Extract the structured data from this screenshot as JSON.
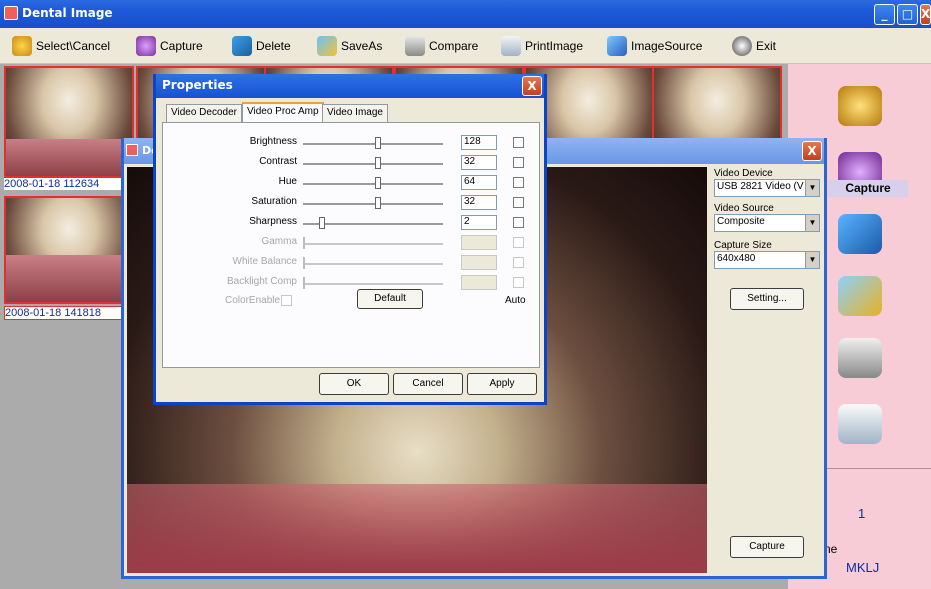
{
  "app": {
    "title": "Dental Image"
  },
  "toolbar": {
    "items": [
      {
        "label": "Select\\Cancel",
        "icon": "film-reel-icon"
      },
      {
        "label": "Capture",
        "icon": "camera-icon"
      },
      {
        "label": "Delete",
        "icon": "clapper-icon"
      },
      {
        "label": "SaveAs",
        "icon": "floppy-icon"
      },
      {
        "label": "Compare",
        "icon": "compare-icon"
      },
      {
        "label": "PrintImage",
        "icon": "printer-icon"
      },
      {
        "label": "ImageSource",
        "icon": "source-icon"
      },
      {
        "label": "Exit",
        "icon": "exit-icon"
      }
    ]
  },
  "thumbnails": [
    {
      "label": "2008-01-18 112634"
    },
    {
      "label": "2008-01-18 141818"
    }
  ],
  "right_panel": {
    "capture_label": "Capture",
    "count": "1",
    "partial_text": "ne",
    "name": "MKLJ"
  },
  "video_window": {
    "title": "De",
    "video_device_label": "Video Device",
    "video_device_value": "USB 2821 Video (V",
    "video_source_label": "Video Source",
    "video_source_value": "Composite",
    "capture_size_label": "Capture Size",
    "capture_size_value": "640x480",
    "setting_button": "Setting...",
    "capture_button": "Capture"
  },
  "properties": {
    "title": "Properties",
    "tabs": [
      "Video Decoder",
      "Video Proc Amp",
      "Video Image"
    ],
    "rows": [
      {
        "label": "Brightness",
        "value": "128"
      },
      {
        "label": "Contrast",
        "value": "32"
      },
      {
        "label": "Hue",
        "value": "64"
      },
      {
        "label": "Saturation",
        "value": "32"
      },
      {
        "label": "Sharpness",
        "value": "2"
      },
      {
        "label": "Gamma",
        "value": ""
      },
      {
        "label": "White Balance",
        "value": ""
      },
      {
        "label": "Backlight Comp",
        "value": ""
      }
    ],
    "color_enable": "ColorEnable",
    "default_button": "Default",
    "auto_label": "Auto",
    "ok": "OK",
    "cancel": "Cancel",
    "apply": "Apply"
  }
}
